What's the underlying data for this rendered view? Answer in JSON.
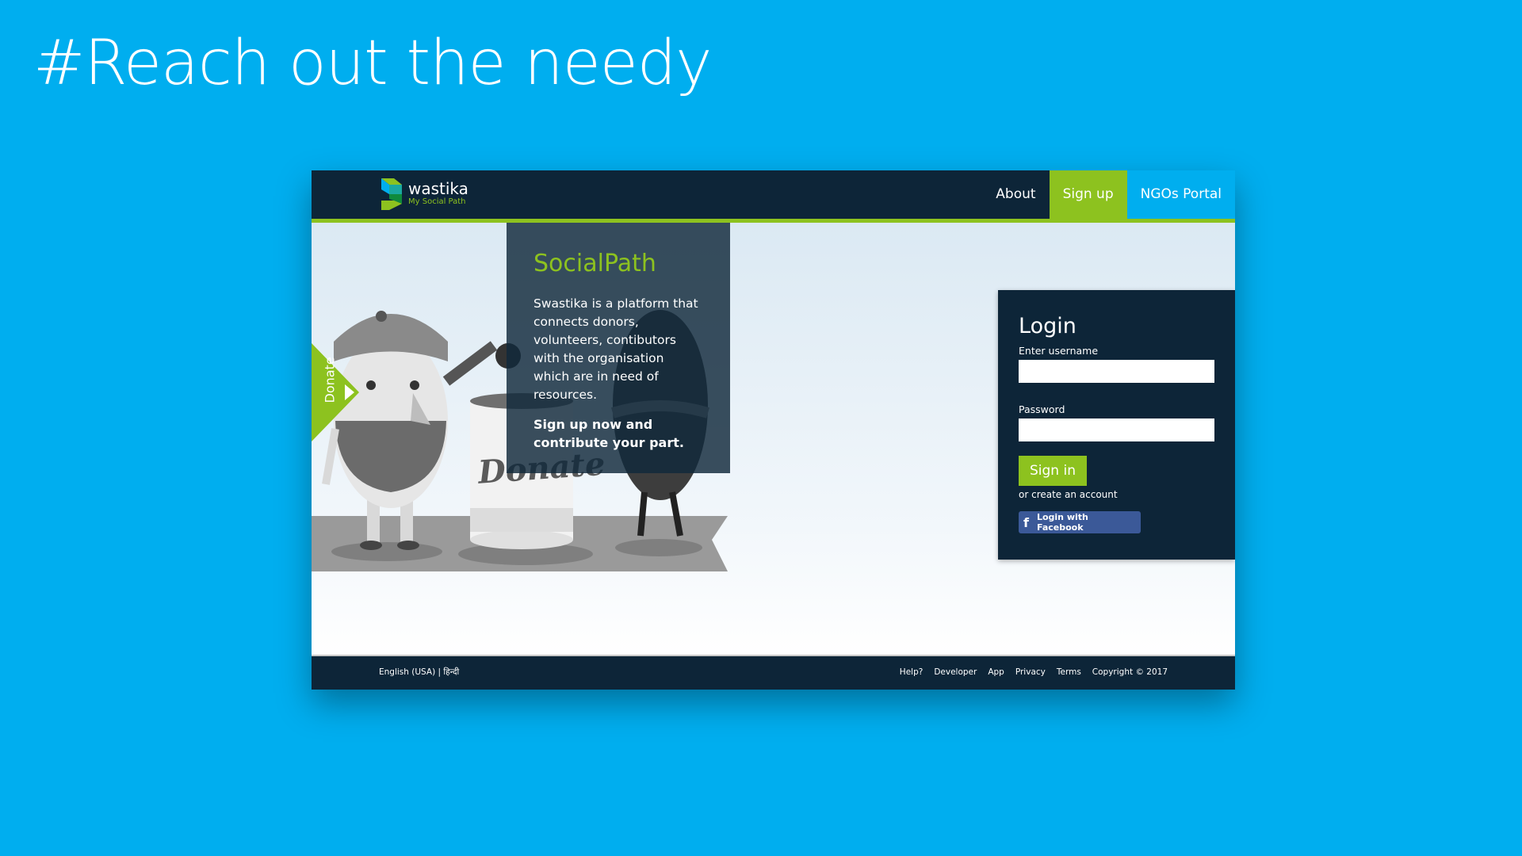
{
  "slide": {
    "title": "#Reach out the needy"
  },
  "site": {
    "logo": {
      "name": "wastika",
      "tagline": "My Social Path"
    },
    "nav": {
      "about": "About",
      "signup": "Sign up",
      "ngos": "NGOs Portal"
    },
    "colors": {
      "navy": "#0d2538",
      "green": "#8dc21f",
      "blue": "#00aeef"
    }
  },
  "hero": {
    "title": "SocialPath",
    "description": "Swastika is a platform that connects donors, volunteers, contibutors with the organisation which are in need of resources.",
    "cta": "Sign up now and contribute your part.",
    "donate_tab": "Donate",
    "can_label": "Donate"
  },
  "login": {
    "title": "Login",
    "username_label": "Enter username",
    "username_value": "",
    "password_label": "Password",
    "password_value": "",
    "signin": "Sign in",
    "create_account": "or create an account",
    "facebook": "Login with Facebook",
    "facebook_icon": "f"
  },
  "footer": {
    "lang_english": "English (USA)",
    "lang_sep": "|",
    "lang_hindi": "हिन्दी",
    "links": [
      "Help?",
      "Developer",
      "App",
      "Privacy",
      "Terms",
      "Copyright © 2017"
    ]
  }
}
